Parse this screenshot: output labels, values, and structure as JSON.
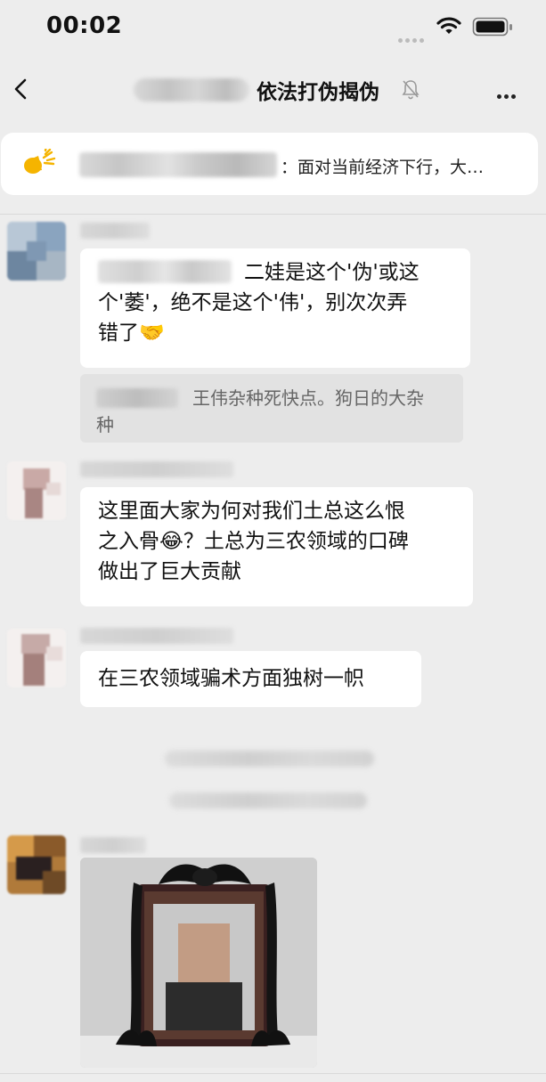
{
  "status_bar": {
    "time": "00:02"
  },
  "nav": {
    "title": "依法打伪揭伪"
  },
  "notice": {
    "text": "：面对当前经济下行，大…"
  },
  "messages": [
    {
      "text_line1": "二娃是这个'伪'或这",
      "text_line2": "个'萎'，绝不是这个'伟'，别次次弄",
      "text_line3": "错了🤝",
      "quote_line1": "王伟杂种死快点。狗日的大杂",
      "quote_line2": "种"
    },
    {
      "line1": "这里面大家为何对我们土总这么恨",
      "line2": "之入骨😂？土总为三农领域的口碑",
      "line3": "做出了巨大贡献"
    },
    {
      "text": "在三农领域骗术方面独树一帜"
    }
  ],
  "icons": {
    "back": "back-chevron-icon",
    "mute": "bell-off-icon",
    "more": "more-icon",
    "notice": "announcement-icon",
    "wifi": "wifi-icon",
    "battery": "battery-icon"
  }
}
